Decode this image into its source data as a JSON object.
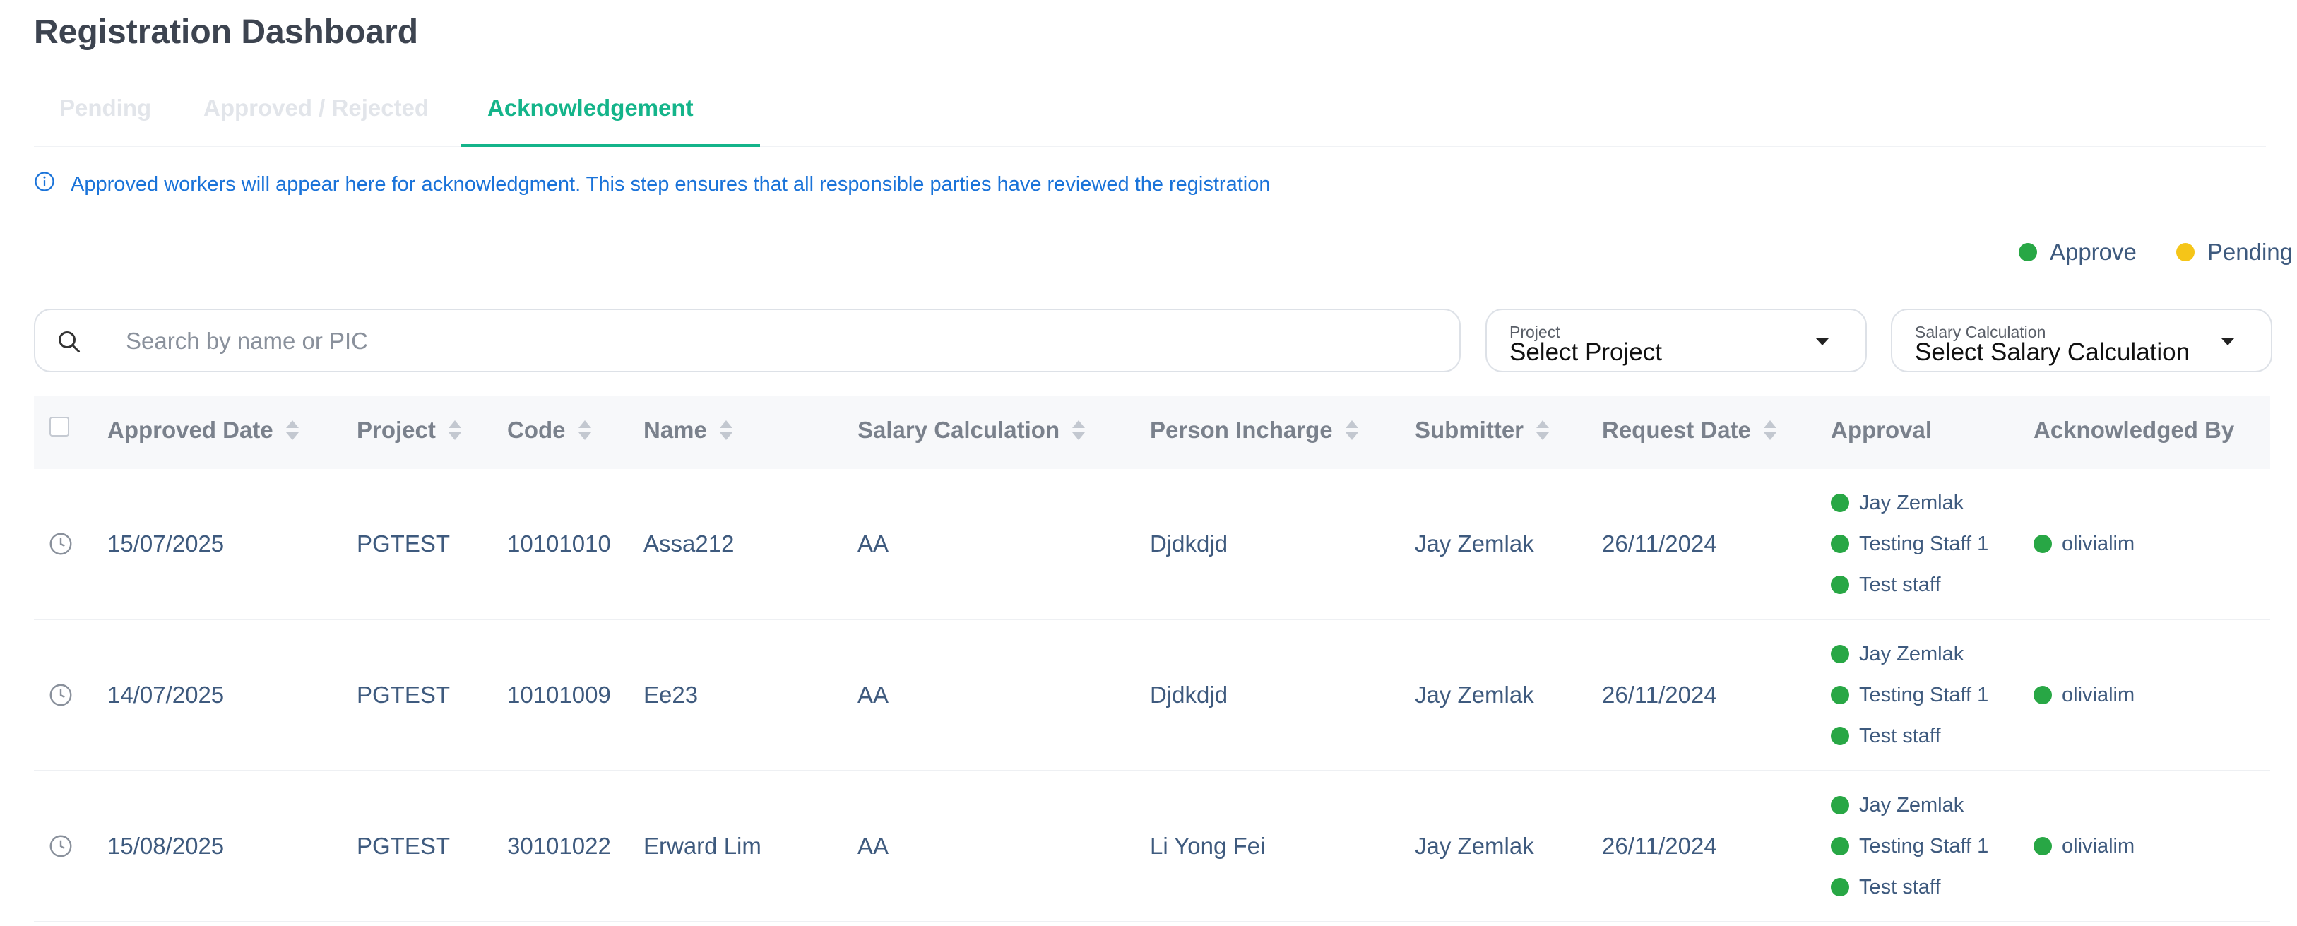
{
  "page": {
    "title": "Registration Dashboard"
  },
  "tabs": [
    {
      "label": "Pending",
      "active": false
    },
    {
      "label": "Approved / Rejected",
      "active": false
    },
    {
      "label": "Acknowledgement",
      "active": true
    }
  ],
  "info": {
    "text": "Approved workers will appear here for acknowledgment. This step ensures that all responsible parties have reviewed the registration"
  },
  "legend": [
    {
      "label": "Approve",
      "color": "#28a745"
    },
    {
      "label": "Pending",
      "color": "#f5c518"
    }
  ],
  "search": {
    "placeholder": "Search by name or PIC",
    "value": ""
  },
  "filters": {
    "project": {
      "label": "Project",
      "value": "Select Project"
    },
    "salary": {
      "label": "Salary Calculation",
      "value": "Select Salary Calculation"
    }
  },
  "table": {
    "columns": [
      "Approved Date",
      "Project",
      "Code",
      "Name",
      "Salary Calculation",
      "Person Incharge",
      "Submitter",
      "Request Date",
      "Approval",
      "Acknowledged By"
    ],
    "rows": [
      {
        "approved_date": "15/07/2025",
        "project": "PGTEST",
        "code": "10101010",
        "name": "Assa212",
        "salary": "AA",
        "pic": "Djdkdjd",
        "submitter": "Jay Zemlak",
        "request_date": "26/11/2024",
        "approval": [
          "Jay Zemlak",
          "Testing Staff 1",
          "Test staff"
        ],
        "acknowledged_by": [
          "olivialim"
        ]
      },
      {
        "approved_date": "14/07/2025",
        "project": "PGTEST",
        "code": "10101009",
        "name": "Ee23",
        "salary": "AA",
        "pic": "Djdkdjd",
        "submitter": "Jay Zemlak",
        "request_date": "26/11/2024",
        "approval": [
          "Jay Zemlak",
          "Testing Staff 1",
          "Test staff"
        ],
        "acknowledged_by": [
          "olivialim"
        ]
      },
      {
        "approved_date": "15/08/2025",
        "project": "PGTEST",
        "code": "30101022",
        "name": "Erward Lim",
        "salary": "AA",
        "pic": "Li Yong Fei",
        "submitter": "Jay Zemlak",
        "request_date": "26/11/2024",
        "approval": [
          "Jay Zemlak",
          "Testing Staff 1",
          "Test staff"
        ],
        "acknowledged_by": [
          "olivialim"
        ]
      }
    ]
  },
  "colors": {
    "accent": "#14b48a",
    "approve": "#28a745",
    "pending": "#f5c518",
    "info": "#1a73d9"
  }
}
